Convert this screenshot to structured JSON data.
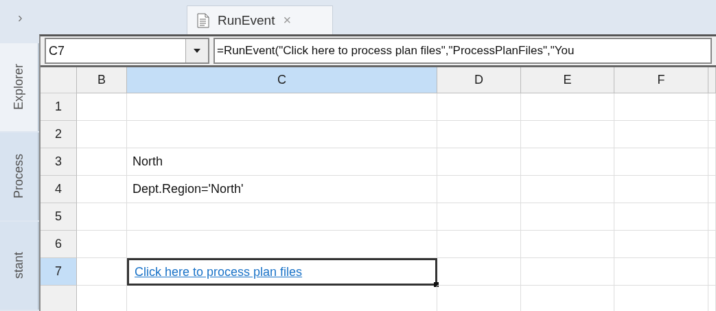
{
  "sidebar_toggle": {
    "label": "›"
  },
  "tabs": [
    {
      "label": "RunEvent",
      "selected": true,
      "close": "×"
    }
  ],
  "side_tabs": [
    {
      "label": "Explorer",
      "selected": true
    },
    {
      "label": "Process",
      "selected": false
    },
    {
      "label": "stant",
      "selected": false
    }
  ],
  "name_box": {
    "value": "C7"
  },
  "formula": {
    "value": "=RunEvent(\"Click here to process plan files\",\"ProcessPlanFiles\",\"You"
  },
  "columns": [
    {
      "label": "B",
      "selected": false
    },
    {
      "label": "C",
      "selected": true
    },
    {
      "label": "D",
      "selected": false
    },
    {
      "label": "E",
      "selected": false
    },
    {
      "label": "F",
      "selected": false
    }
  ],
  "rows": [
    {
      "label": "1",
      "selected": false,
      "cells": [
        {
          "selected": false
        },
        {
          "selected": false
        },
        {
          "selected": false
        },
        {
          "selected": false
        },
        {
          "selected": false
        }
      ]
    },
    {
      "label": "2",
      "selected": false,
      "cells": [
        {
          "selected": false
        },
        {
          "selected": false
        },
        {
          "selected": false
        },
        {
          "selected": false
        },
        {
          "selected": false
        }
      ]
    },
    {
      "label": "3",
      "selected": false,
      "cells": [
        {
          "selected": false
        },
        {
          "text": "North",
          "kind": "text",
          "selected": false
        },
        {
          "selected": false
        },
        {
          "selected": false
        },
        {
          "selected": false
        }
      ]
    },
    {
      "label": "4",
      "selected": false,
      "cells": [
        {
          "selected": false
        },
        {
          "text": "Dept.Region='North'",
          "kind": "text",
          "selected": false
        },
        {
          "selected": false
        },
        {
          "selected": false
        },
        {
          "selected": false
        }
      ]
    },
    {
      "label": "5",
      "selected": false,
      "cells": [
        {
          "selected": false
        },
        {
          "selected": false
        },
        {
          "selected": false
        },
        {
          "selected": false
        },
        {
          "selected": false
        }
      ]
    },
    {
      "label": "6",
      "selected": false,
      "cells": [
        {
          "selected": false
        },
        {
          "selected": false
        },
        {
          "selected": false
        },
        {
          "selected": false
        },
        {
          "selected": false
        }
      ]
    },
    {
      "label": "7",
      "selected": true,
      "cells": [
        {
          "selected": false
        },
        {
          "text": "Click here to process plan files",
          "kind": "link",
          "selected": true
        },
        {
          "selected": false
        },
        {
          "selected": false
        },
        {
          "selected": false
        }
      ]
    }
  ]
}
